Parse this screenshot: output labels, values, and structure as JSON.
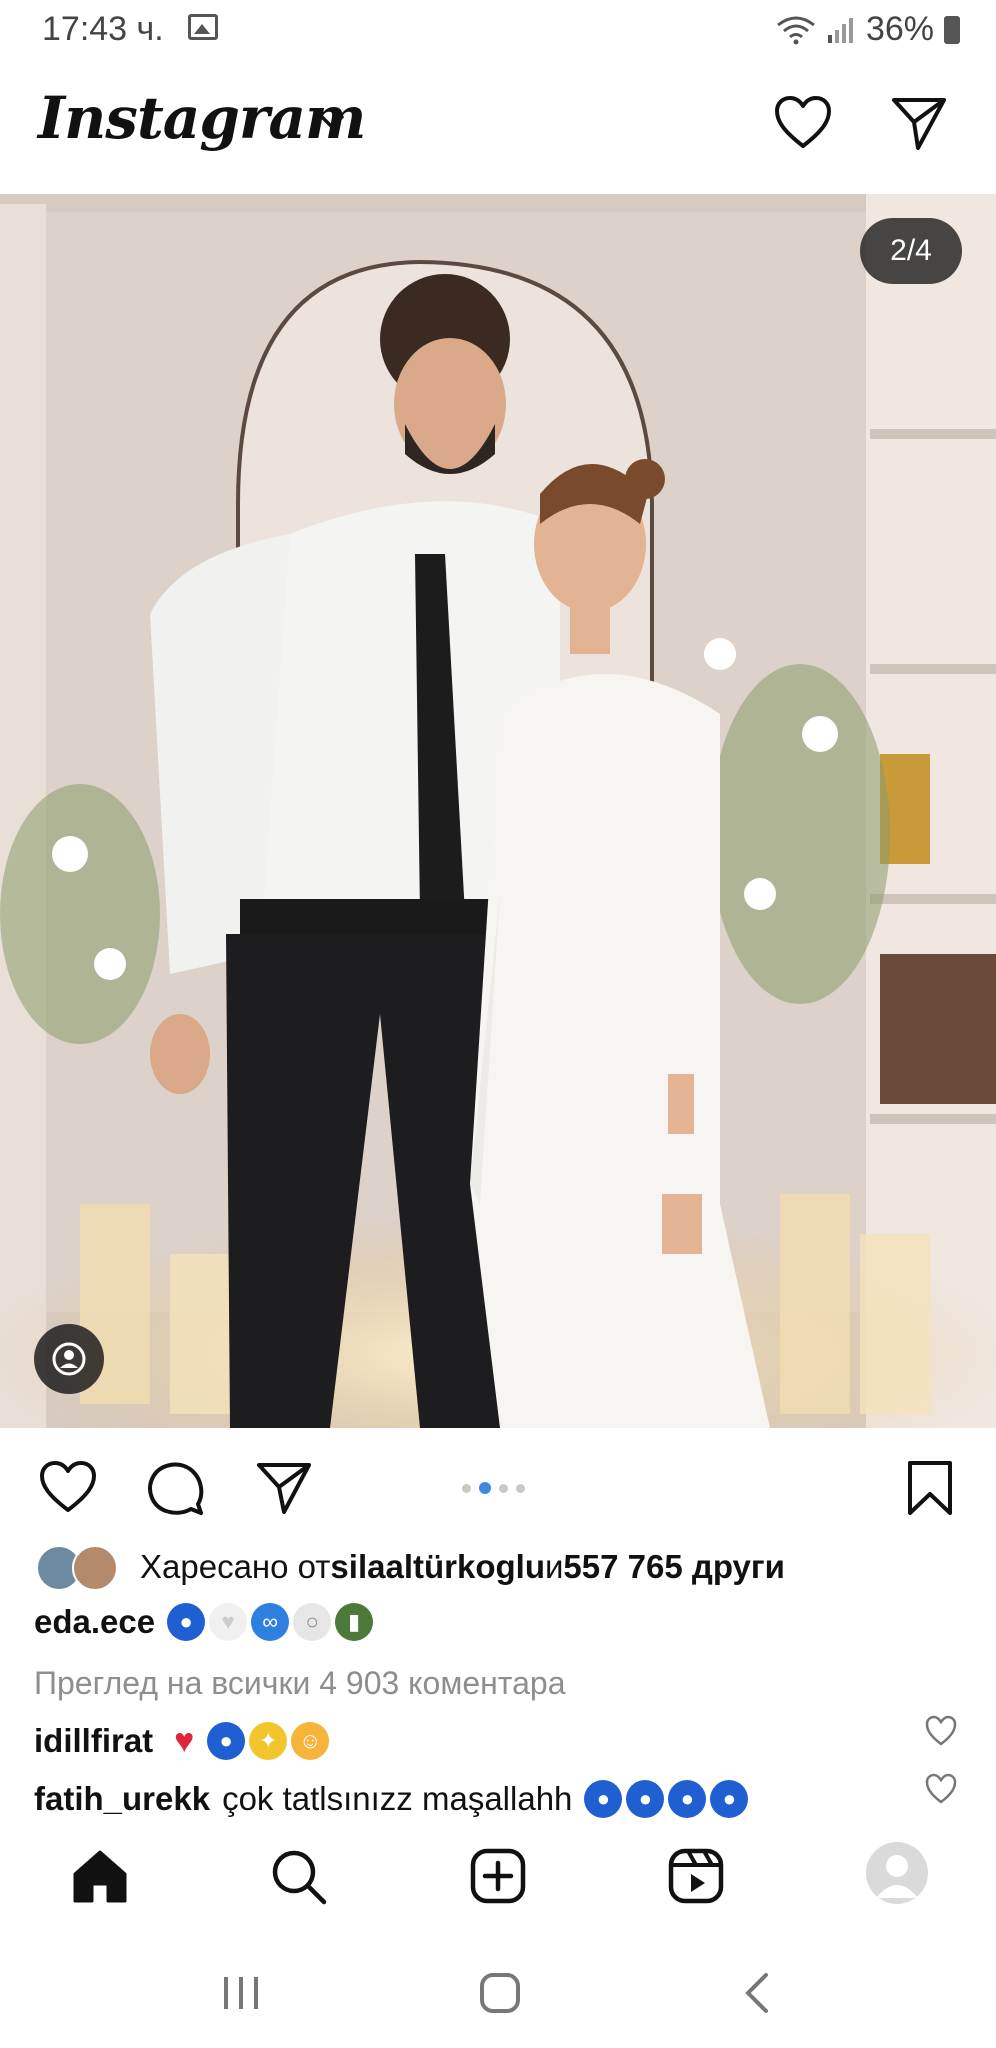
{
  "status_bar": {
    "time": "17:43 ч.",
    "battery": "36%"
  },
  "header": {
    "logo_text": "Instagram"
  },
  "post": {
    "image_counter": "2/4",
    "carousel_total": 4,
    "carousel_active": 2
  },
  "likes": {
    "prefix": "Харесано от ",
    "user": "silaaltürkoglu",
    "middle": " и ",
    "count": "557 765 други"
  },
  "caption": {
    "username": "eda.ece"
  },
  "comments": {
    "view_all": "Преглед на всички 4 903 коментара",
    "items": [
      {
        "username": "idillfirat",
        "text": ""
      },
      {
        "username": "fatih_urekk",
        "text": "çok tatlsınızz maşallahh"
      }
    ]
  },
  "colors": {
    "accent_blue": "#3a8be0",
    "muted_text": "#8e8e8e",
    "heart_red": "#e0243a"
  }
}
